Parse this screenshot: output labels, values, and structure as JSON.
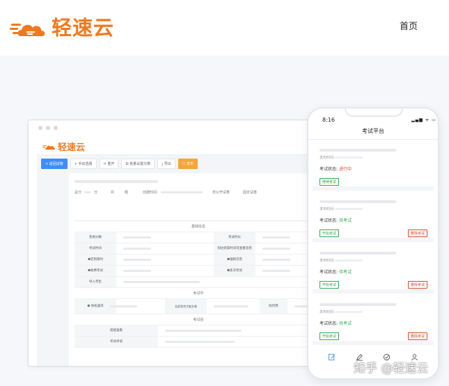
{
  "brand": {
    "name": "轻速云",
    "color": "#f3781c"
  },
  "nav": {
    "home": "首页"
  },
  "desktop": {
    "logo_text": "轻速云",
    "toolbar": [
      "< 返回试卷",
      "+ 手动选题",
      "⟳ 重开",
      "⊞ 批量设置分数",
      "⤓ 导出",
      "☐ 发布"
    ],
    "summary": {
      "total": "总分",
      "points": "分",
      "count_prefix": "共",
      "count_suffix": "题",
      "created": "创建时间:",
      "public": "非公开试卷",
      "fixed": "固定试卷"
    },
    "sections": {
      "basic": "基础信息",
      "during": "考试中",
      "after": "考试后"
    },
    "basic_rows": [
      {
        "left": "及格分数",
        "right": "考试时长"
      },
      {
        "left": "考试时间",
        "right": "到达结束时间可查看答卷"
      },
      {
        "left": "❶迟到限时",
        "right": "❶强制交卷"
      },
      {
        "left": "❶收费考试",
        "right": "❶多次考试"
      },
      {
        "left": "导入考生",
        "right": ""
      }
    ],
    "during_row": {
      "a": "❶ 防机器作",
      "b": "全部答完才能交卷",
      "c": "防作弊"
    },
    "after_rows": [
      "成绩查看",
      "考试评语"
    ]
  },
  "phone": {
    "time": "8:16",
    "status_icons": "▂▄▆ ᯤ ▭",
    "title": "考试平台",
    "publish_label": "发布时间:",
    "status_label": "考试状态:",
    "cards": [
      {
        "status": "进行中",
        "status_color": "#e0462b",
        "primary_btn": "继续考试",
        "delete_btn": ""
      },
      {
        "status": "待考试",
        "status_color": "#2fa84f",
        "primary_btn": "开始考试",
        "delete_btn": "删除考试"
      },
      {
        "status": "待考试",
        "status_color": "#2fa84f",
        "primary_btn": "开始考试",
        "delete_btn": "删除考试"
      },
      {
        "status": "待考试",
        "status_color": "#2fa84f",
        "primary_btn": "开始考试",
        "delete_btn": "删除考试"
      }
    ],
    "tabs": [
      "edit-doc-icon",
      "pen-icon",
      "check-circle-icon",
      "user-icon"
    ],
    "accent": "#3e8ef7"
  },
  "watermark": "知乎 @轻速云"
}
